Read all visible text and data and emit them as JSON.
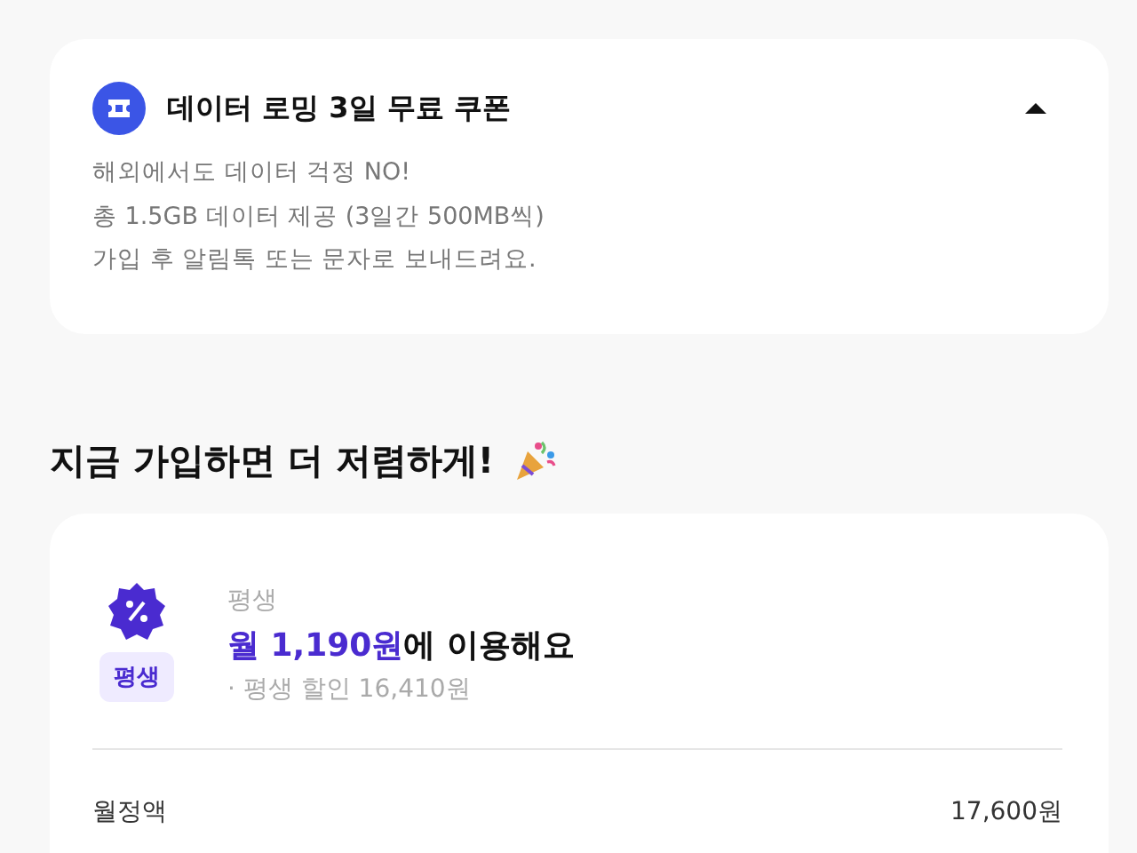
{
  "coupon": {
    "title": "데이터 로밍 3일 무료 쿠폰",
    "expanded": true,
    "lines": [
      "해외에서도 데이터 걱정 NO!",
      "총 1.5GB 데이터 제공 (3일간 500MB씩)",
      "가입 후 알림톡 또는 문자로 보내드려요."
    ]
  },
  "promo": {
    "heading": "지금 가입하면 더 저렴하게!",
    "plan": {
      "badge": "평생",
      "label": "평생",
      "price": "월 1,190원",
      "price_suffix": "에 이용해요",
      "discount": "· 평생 할인 16,410원"
    },
    "rows": [
      {
        "label": "월정액",
        "value": "17,600원"
      }
    ]
  }
}
